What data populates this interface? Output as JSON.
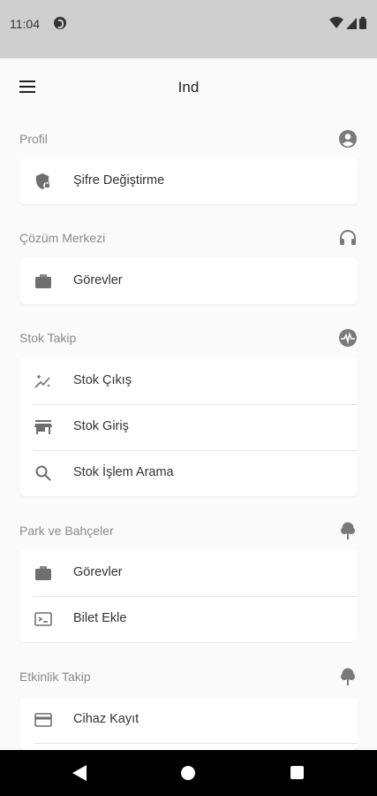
{
  "status": {
    "time": "11:04"
  },
  "app": {
    "title": "Ind"
  },
  "sections": [
    {
      "label": "Profil",
      "icon": "account-circle-icon",
      "items": [
        {
          "label": "Şifre Değiştirme",
          "icon": "shield-lock-icon"
        }
      ]
    },
    {
      "label": "Çözüm Merkezi",
      "icon": "headset-icon",
      "items": [
        {
          "label": "Görevler",
          "icon": "briefcase-icon"
        }
      ]
    },
    {
      "label": "Stok Takip",
      "icon": "pulse-icon",
      "items": [
        {
          "label": "Stok Çıkış",
          "icon": "sparkle-trend-icon"
        },
        {
          "label": "Stok Giriş",
          "icon": "store-icon"
        },
        {
          "label": "Stok İşlem Arama",
          "icon": "search-icon"
        }
      ]
    },
    {
      "label": "Park ve Bahçeler",
      "icon": "tree-icon",
      "items": [
        {
          "label": "Görevler",
          "icon": "briefcase-icon"
        },
        {
          "label": "Bilet Ekle",
          "icon": "terminal-icon"
        }
      ]
    },
    {
      "label": "Etkinlik Takip",
      "icon": "tree-icon",
      "items": [
        {
          "label": "Cihaz Kayıt",
          "icon": "credit-card-icon"
        }
      ]
    }
  ]
}
